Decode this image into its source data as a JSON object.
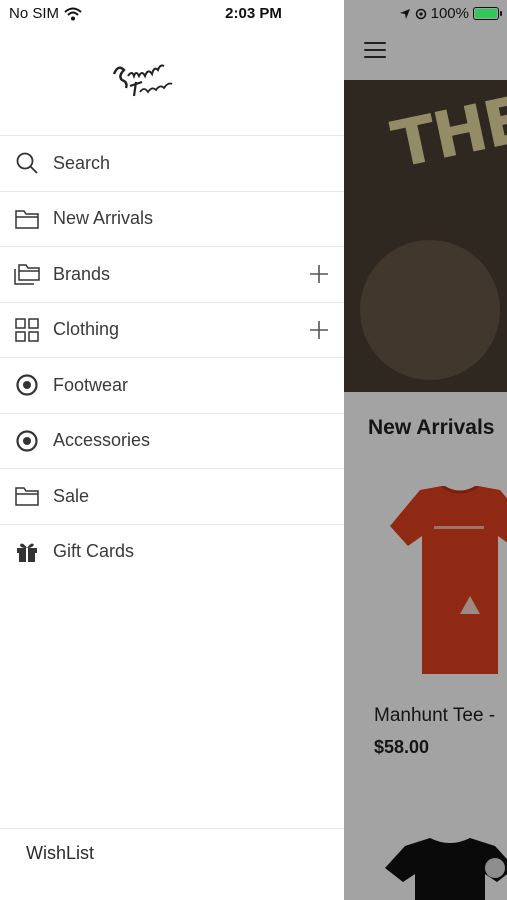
{
  "status_bar": {
    "carrier": "No SIM",
    "time": "2:03 PM",
    "battery": "100%"
  },
  "drawer": {
    "logo_text": "Sammy's Fashion",
    "menu": [
      {
        "label": "Search",
        "icon": "search-icon",
        "expandable": false
      },
      {
        "label": "New Arrivals",
        "icon": "folder-icon",
        "expandable": false
      },
      {
        "label": "Brands",
        "icon": "folders-icon",
        "expandable": true
      },
      {
        "label": "Clothing",
        "icon": "grid-icon",
        "expandable": true
      },
      {
        "label": "Footwear",
        "icon": "target-icon",
        "expandable": false
      },
      {
        "label": "Accessories",
        "icon": "target-icon",
        "expandable": false
      },
      {
        "label": "Sale",
        "icon": "folder-icon",
        "expandable": false
      },
      {
        "label": "Gift Cards",
        "icon": "gift-icon",
        "expandable": false
      }
    ],
    "footer_label": "WishList"
  },
  "background": {
    "hero_text": "THE",
    "section_title": "New Arrivals",
    "product_name": "Manhunt Tee -",
    "product_price": "$58.00"
  },
  "colors": {
    "accent_tee": "#e0401f",
    "hero_bg": "#4a3f34",
    "battery": "#34c759"
  }
}
